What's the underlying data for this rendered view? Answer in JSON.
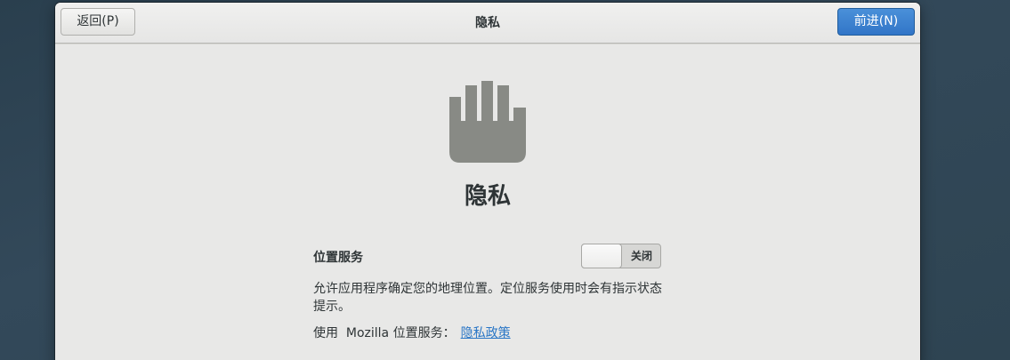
{
  "header": {
    "back_label": "返回(P)",
    "title": "隐私",
    "next_label": "前进(N)"
  },
  "colors": {
    "accent": "#3b82d4",
    "link": "#2a76c6",
    "icon": "#888a85"
  },
  "hero": {
    "icon": "hand-stop-icon",
    "title": "隐私"
  },
  "location": {
    "label": "位置服务",
    "switch_state": "关闭",
    "description": "允许应用程序确定您的地理位置。定位服务使用时会有指示状态提示。",
    "provider_prefix": "使用  Mozilla 位置服务：",
    "policy_link": "隐私政策"
  }
}
